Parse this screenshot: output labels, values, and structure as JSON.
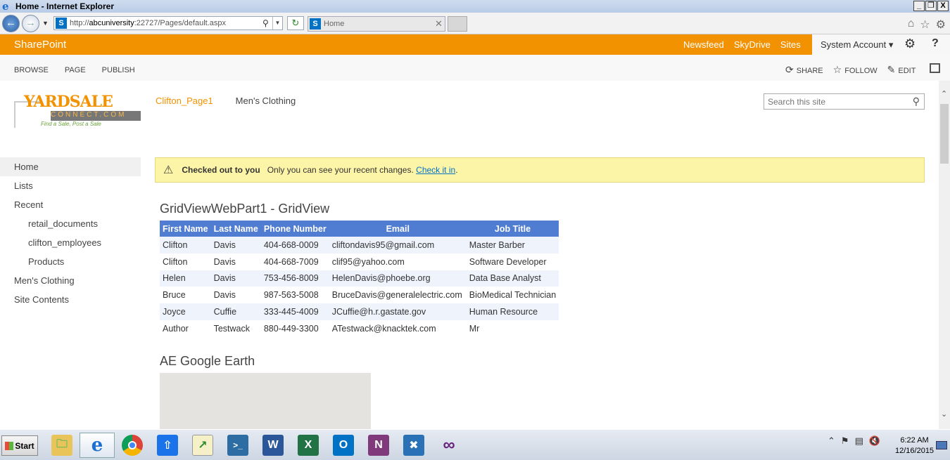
{
  "window": {
    "title": "Home - Internet Explorer",
    "controls": [
      "_",
      "❐",
      "X"
    ]
  },
  "browser": {
    "address_prefix": "http://",
    "address_host": "abcuniversity",
    "address_rest": ":22727/Pages/default.aspx",
    "tab_title": "Home"
  },
  "suitebar": {
    "brand": "SharePoint",
    "links": [
      "Newsfeed",
      "SkyDrive",
      "Sites"
    ],
    "account": "System Account ▾"
  },
  "ribbon": {
    "tabs": [
      "BROWSE",
      "PAGE",
      "PUBLISH"
    ],
    "share": "SHARE",
    "follow": "FOLLOW",
    "edit": "EDIT"
  },
  "logo": {
    "line1": "YARDSALE",
    "line2": "CONNECT.COM",
    "tagline": "Find a Sale, Post a Sale"
  },
  "topnav": [
    "Clifton_Page1",
    "Men's Clothing"
  ],
  "search": {
    "placeholder": "Search this site"
  },
  "leftnav": [
    {
      "label": "Home",
      "level": 0,
      "selected": true
    },
    {
      "label": "Lists",
      "level": 0
    },
    {
      "label": "Recent",
      "level": 0
    },
    {
      "label": "retail_documents",
      "level": 1
    },
    {
      "label": "clifton_employees",
      "level": 1
    },
    {
      "label": "Products",
      "level": 1
    },
    {
      "label": "Men's Clothing",
      "level": 0
    },
    {
      "label": "Site Contents",
      "level": 0
    }
  ],
  "notice": {
    "bold": "Checked out to you",
    "text": "Only you can see your recent changes.",
    "link": "Check it in",
    "period": "."
  },
  "gridview": {
    "title": "GridViewWebPart1 - GridView",
    "columns": [
      "First Name",
      "Last Name",
      "Phone Number",
      "Email",
      "Job Title"
    ],
    "rows": [
      [
        "Clifton",
        "Davis",
        "404-668-0009",
        "cliftondavis95@gmail.com",
        "Master Barber"
      ],
      [
        "Clifton",
        "Davis",
        "404-668-7009",
        "clif95@yahoo.com",
        "Software Developer"
      ],
      [
        "Helen",
        "Davis",
        "753-456-8009",
        "HelenDavis@phoebe.org",
        "Data Base Analyst"
      ],
      [
        "Bruce",
        "Davis",
        "987-563-5008",
        "BruceDavis@generalelectric.com",
        "BioMedical Technician"
      ],
      [
        "Joyce",
        "Cuffie",
        "333-445-4009",
        "JCuffie@h.r.gastate.gov",
        "Human Resource"
      ],
      [
        "Author",
        "Testwack",
        "880-449-3300",
        "ATestwack@knacktek.com",
        "Mr"
      ]
    ]
  },
  "google_earth": {
    "title": "AE Google Earth"
  },
  "taskbar": {
    "start": "Start",
    "apps": [
      "file-explorer",
      "internet-explorer",
      "chrome",
      "upload",
      "notepad-chart",
      "powershell",
      "word",
      "excel",
      "outlook",
      "onenote",
      "tools",
      "visual-studio"
    ],
    "time": "6:22 AM",
    "date": "12/16/2015"
  },
  "colors": {
    "sharepoint_orange": "#f39200",
    "grid_header": "#507cd1",
    "grid_alt_row": "#eff3fb",
    "notice_bg": "#fcf4a7"
  }
}
